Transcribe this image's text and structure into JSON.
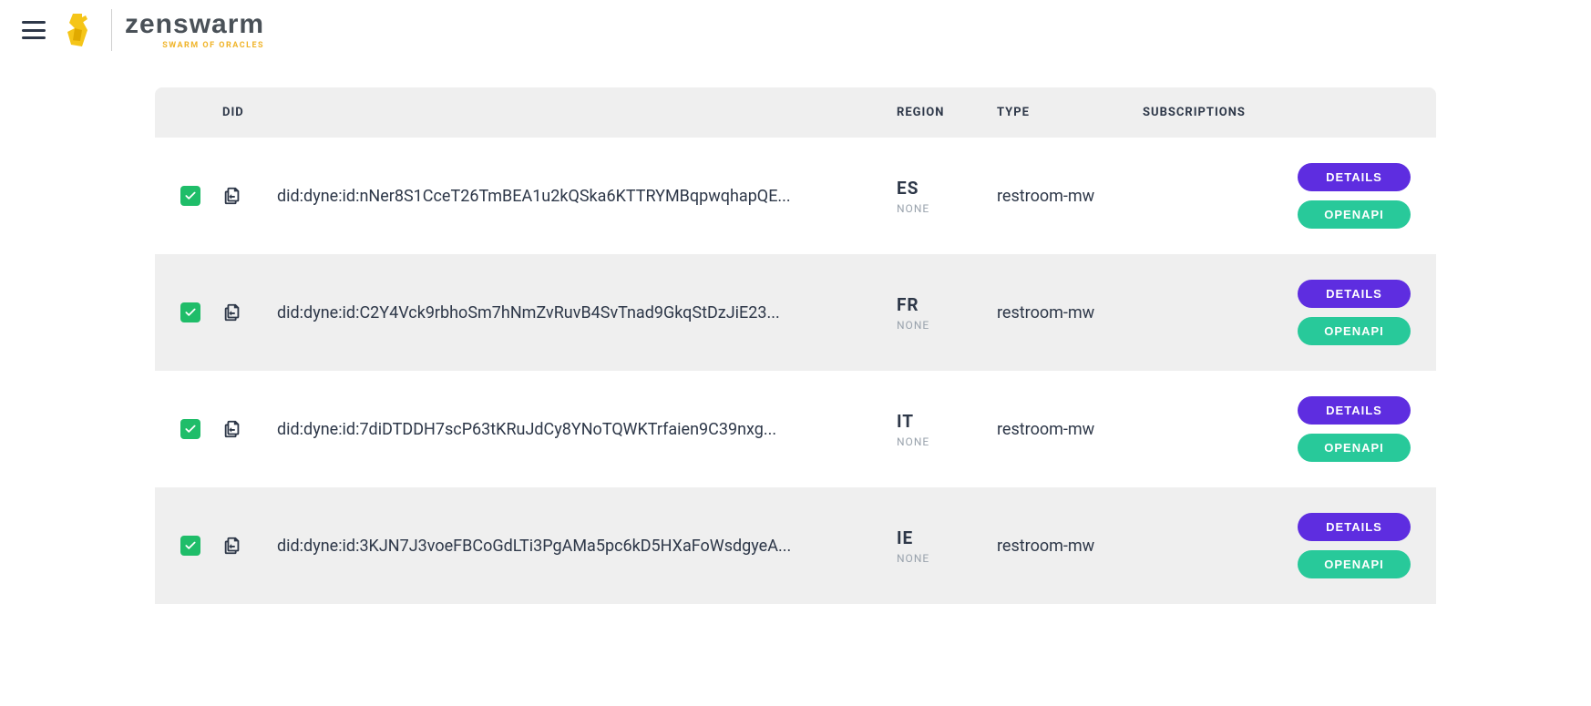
{
  "brand": {
    "name": "zenswarm",
    "tagline": "SWARM OF ORACLES"
  },
  "table": {
    "headers": {
      "did": "DID",
      "region": "REGION",
      "type": "TYPE",
      "subscriptions": "SUBSCRIPTIONS"
    },
    "button_labels": {
      "details": "DETAILS",
      "openapi": "OPENAPI"
    },
    "region_sub": "NONE",
    "rows": [
      {
        "did": "did:dyne:id:nNer8S1CceT26TmBEA1u2kQSka6KTTRYMBqpwqhapQE...",
        "region": "ES",
        "type": "restroom-mw"
      },
      {
        "did": "did:dyne:id:C2Y4Vck9rbhoSm7hNmZvRuvB4SvTnad9GkqStDzJiE23...",
        "region": "FR",
        "type": "restroom-mw"
      },
      {
        "did": "did:dyne:id:7diDTDDH7scP63tKRuJdCy8YNoTQWKTrfaien9C39nxg...",
        "region": "IT",
        "type": "restroom-mw"
      },
      {
        "did": "did:dyne:id:3KJN7J3voeFBCoGdLTi3PgAMa5pc6kD5HXaFoWsdgyeA...",
        "region": "IE",
        "type": "restroom-mw"
      }
    ]
  }
}
